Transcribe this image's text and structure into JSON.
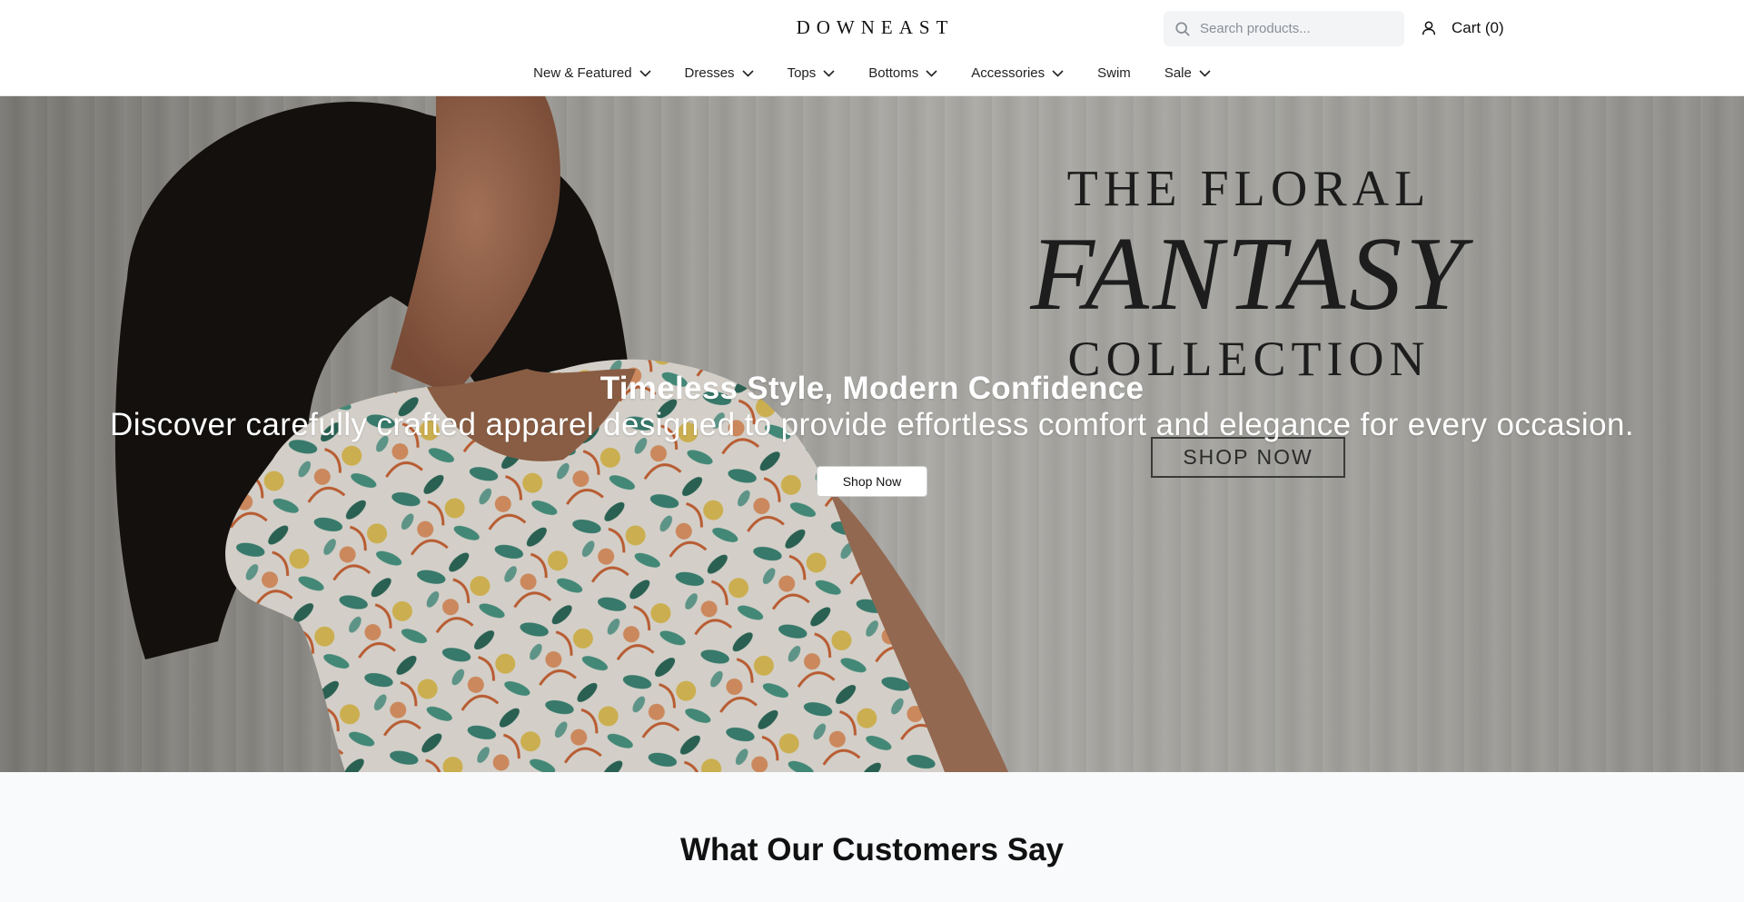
{
  "header": {
    "logo": "DOWNEAST",
    "search_placeholder": "Search products...",
    "cart_label": "Cart (0)"
  },
  "nav": {
    "items": [
      {
        "label": "New & Featured",
        "dropdown": true
      },
      {
        "label": "Dresses",
        "dropdown": true
      },
      {
        "label": "Tops",
        "dropdown": true
      },
      {
        "label": "Bottoms",
        "dropdown": true
      },
      {
        "label": "Accessories",
        "dropdown": true
      },
      {
        "label": "Swim",
        "dropdown": false
      },
      {
        "label": "Sale",
        "dropdown": true
      }
    ]
  },
  "hero": {
    "promo_line1": "THE FLORAL",
    "promo_line2": "FANTASY",
    "promo_line3": "COLLECTION",
    "promo_button": "SHOP NOW",
    "title": "Timeless Style, Modern Confidence",
    "subtitle": "Discover carefully crafted apparel designed to provide effortless comfort and elegance for every occasion.",
    "cta_label": "Shop Now"
  },
  "testimonials": {
    "heading": "What Our Customers Say"
  },
  "icons": {
    "search": "search-icon",
    "user": "user-icon",
    "chevron": "chevron-down-icon"
  }
}
